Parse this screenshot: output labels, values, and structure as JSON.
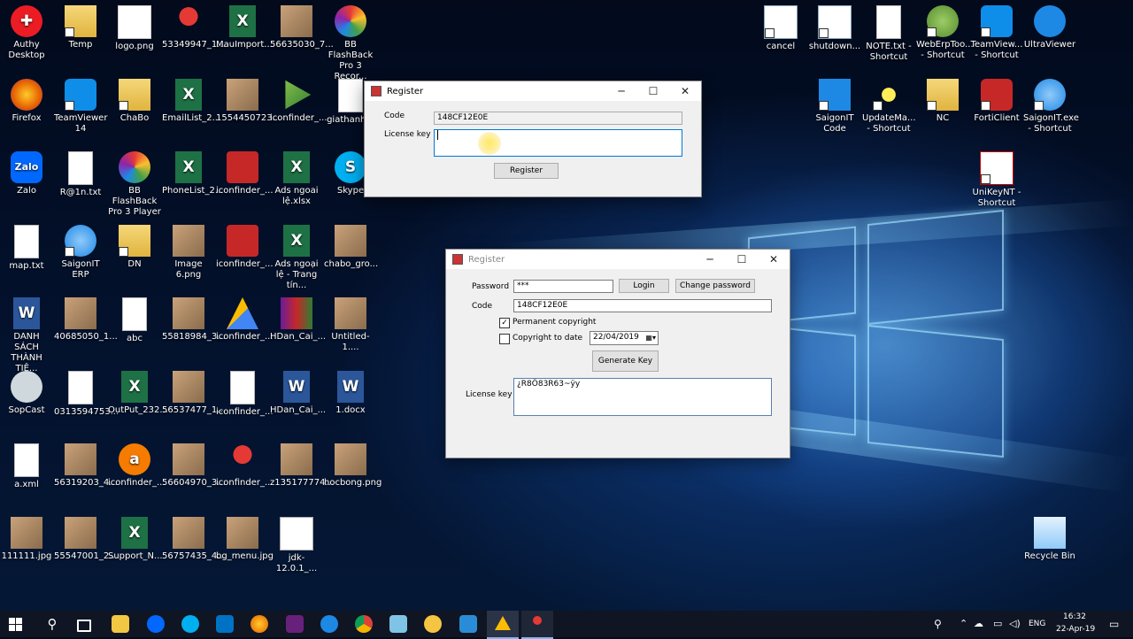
{
  "desktop": {
    "icons": [
      {
        "label": "Authy Desktop",
        "kind": "authy"
      },
      {
        "label": "Temp",
        "kind": "folder"
      },
      {
        "label": "logo.png",
        "kind": "logo"
      },
      {
        "label": "53349947_1...",
        "kind": "map-pin"
      },
      {
        "label": "MauImport...",
        "kind": "excel"
      },
      {
        "label": "56635030_7...",
        "kind": "photo"
      },
      {
        "label": "BB FlashBack Pro 3 Recor...",
        "kind": "flashback"
      },
      {
        "label": "Firefox",
        "kind": "firefox"
      },
      {
        "label": "TeamViewer 14",
        "kind": "teamviewer"
      },
      {
        "label": "ChaBo",
        "kind": "folder"
      },
      {
        "label": "EmailList_2...",
        "kind": "excel"
      },
      {
        "label": "1554450723...",
        "kind": "photo"
      },
      {
        "label": "iconfinder_...",
        "kind": "play"
      },
      {
        "label": "giathanh...",
        "kind": "doc"
      },
      {
        "label": "Zalo",
        "kind": "zalo"
      },
      {
        "label": "R@1n.txt",
        "kind": "doc"
      },
      {
        "label": "BB FlashBack Pro 3 Player",
        "kind": "flashback"
      },
      {
        "label": "PhoneList_2...",
        "kind": "excel"
      },
      {
        "label": "iconfinder_...",
        "kind": "red-square"
      },
      {
        "label": "Ads ngoai lệ.xlsx",
        "kind": "excel"
      },
      {
        "label": "Skype",
        "kind": "skype"
      },
      {
        "label": "map.txt",
        "kind": "doc"
      },
      {
        "label": "SaigonIT ERP",
        "kind": "saigonit"
      },
      {
        "label": "DN",
        "kind": "folder"
      },
      {
        "label": "Image 6.png",
        "kind": "photo"
      },
      {
        "label": "iconfinder_...",
        "kind": "red-square"
      },
      {
        "label": "Ads ngoại lệ - Trang tín...",
        "kind": "excel"
      },
      {
        "label": "chabo_gro...",
        "kind": "photo"
      },
      {
        "label": "DANH SÁCH THÀNH TIÊ...",
        "kind": "word"
      },
      {
        "label": "40685050_1...",
        "kind": "photo"
      },
      {
        "label": "abc",
        "kind": "doc"
      },
      {
        "label": "55818984_3...",
        "kind": "photo"
      },
      {
        "label": "iconfinder_...",
        "kind": "ads"
      },
      {
        "label": "HDan_Cai_...",
        "kind": "winrar"
      },
      {
        "label": "Untitled-1....",
        "kind": "photo"
      },
      {
        "label": "SopCast",
        "kind": "sopcast"
      },
      {
        "label": "0313594753...",
        "kind": "doc"
      },
      {
        "label": "OutPut_232...",
        "kind": "excel"
      },
      {
        "label": "56537477_1...",
        "kind": "photo"
      },
      {
        "label": "iconfinder_...",
        "kind": "doc"
      },
      {
        "label": "HDan_Cai_...",
        "kind": "word"
      },
      {
        "label": "1.docx",
        "kind": "word"
      },
      {
        "label": "a.xml",
        "kind": "doc"
      },
      {
        "label": "56319203_4...",
        "kind": "photo"
      },
      {
        "label": "iconfinder_...",
        "kind": "amazon"
      },
      {
        "label": "56604970_3...",
        "kind": "photo"
      },
      {
        "label": "iconfinder_...",
        "kind": "map-pin"
      },
      {
        "label": "z135177774...",
        "kind": "photo"
      },
      {
        "label": "hocbong.png",
        "kind": "photo"
      },
      {
        "label": "111111.jpg",
        "kind": "photo"
      },
      {
        "label": "55547001_2...",
        "kind": "photo"
      },
      {
        "label": "Support_N...",
        "kind": "excel"
      },
      {
        "label": "56757435_4...",
        "kind": "photo"
      },
      {
        "label": "bg_menu.jpg",
        "kind": "photo"
      },
      {
        "label": "jdk-12.0.1_...",
        "kind": "java"
      },
      {
        "label": "cancel",
        "kind": "shortcut"
      },
      {
        "label": "shutdown...",
        "kind": "shortcut"
      },
      {
        "label": "NOTE.txt - Shortcut",
        "kind": "doc"
      },
      {
        "label": "WebErpToo... - Shortcut",
        "kind": "webErp"
      },
      {
        "label": "TeamView... - Shortcut",
        "kind": "teamviewer"
      },
      {
        "label": "UltraViewer",
        "kind": "ultraviewer"
      },
      {
        "label": "SaigonIT Code",
        "kind": "windows"
      },
      {
        "label": "UpdateMa... - Shortcut",
        "kind": "star"
      },
      {
        "label": "NC",
        "kind": "folder"
      },
      {
        "label": "FortiClient",
        "kind": "forti"
      },
      {
        "label": "SaigonIT.exe - Shortcut",
        "kind": "saigonit"
      },
      {
        "label": "UniKeyNT - Shortcut",
        "kind": "unikey"
      },
      {
        "label": "Recycle Bin",
        "kind": "recycle"
      }
    ]
  },
  "register_small": {
    "title": "Register",
    "code_label": "Code",
    "code_value": "148CF12E0E",
    "license_label": "License key",
    "license_value": "",
    "register_button": "Register"
  },
  "register_main": {
    "title": "Register",
    "password_label": "Password",
    "password_value": "***",
    "login_button": "Login",
    "change_password_button": "Change password",
    "code_label": "Code",
    "code_value": "148CF12E0E",
    "permanent_label": "Permanent copyright",
    "permanent_checked": true,
    "todate_label": "Copyright to date",
    "todate_checked": false,
    "date_value": "22/04/2019",
    "generate_button": "Generate Key",
    "license_label": "License key",
    "license_value": "¿R8Ô83R63~ÿy"
  },
  "taskbar": {
    "language": "ENG",
    "time": "16:32",
    "date": "22-Apr-19"
  }
}
